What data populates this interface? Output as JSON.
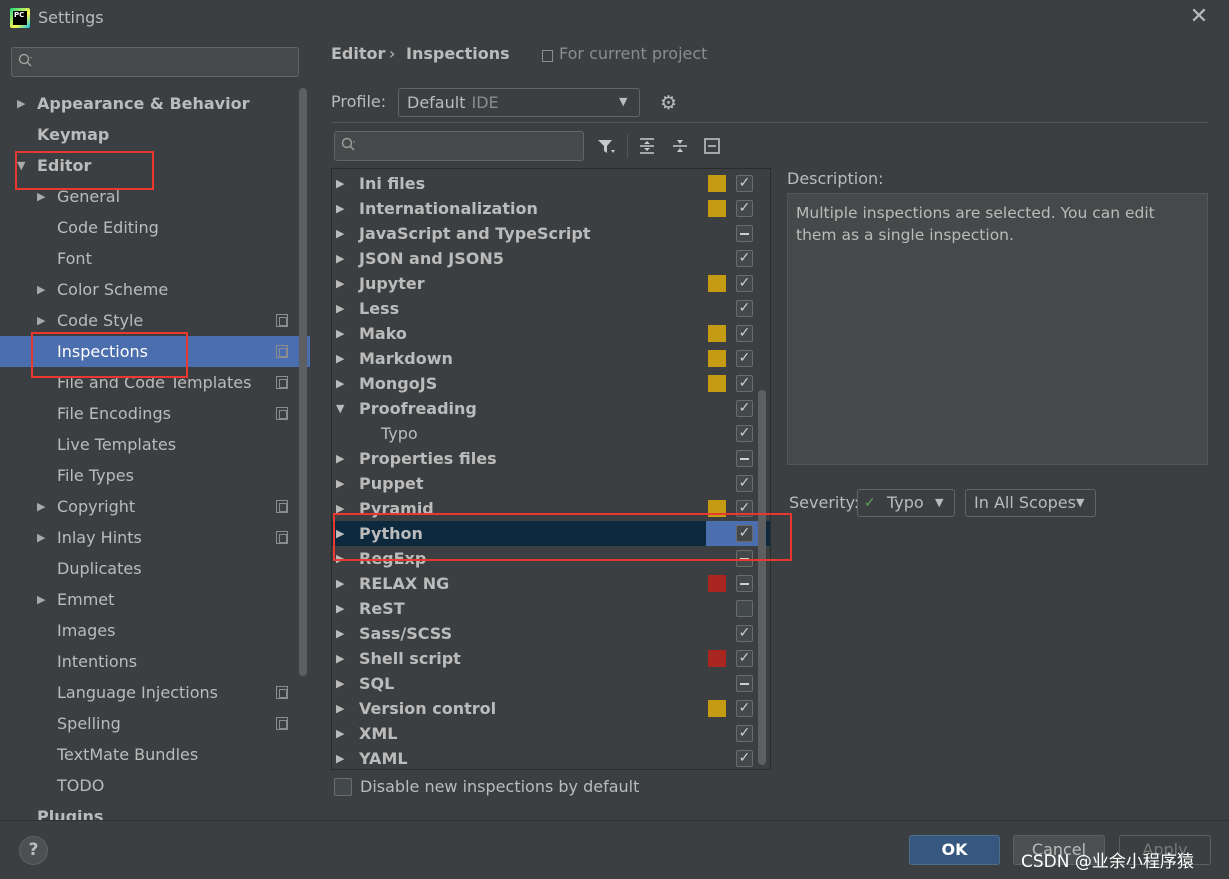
{
  "window": {
    "title": "Settings",
    "icon_text": "PC"
  },
  "sidebar": {
    "search_placeholder": "",
    "items": [
      {
        "label": "Appearance & Behavior",
        "expandable": true,
        "expanded": false,
        "bold": true,
        "level": 0
      },
      {
        "label": "Keymap",
        "expandable": false,
        "bold": true,
        "level": 0
      },
      {
        "label": "Editor",
        "expandable": true,
        "expanded": true,
        "bold": true,
        "level": 0
      },
      {
        "label": "General",
        "expandable": true,
        "level": 1
      },
      {
        "label": "Code Editing",
        "level": 1
      },
      {
        "label": "Font",
        "level": 1
      },
      {
        "label": "Color Scheme",
        "expandable": true,
        "level": 1
      },
      {
        "label": "Code Style",
        "expandable": true,
        "level": 1,
        "project": true
      },
      {
        "label": "Inspections",
        "level": 1,
        "project": true,
        "selected": true
      },
      {
        "label": "File and Code Templates",
        "level": 1,
        "project": true
      },
      {
        "label": "File Encodings",
        "level": 1,
        "project": true
      },
      {
        "label": "Live Templates",
        "level": 1
      },
      {
        "label": "File Types",
        "level": 1
      },
      {
        "label": "Copyright",
        "expandable": true,
        "level": 1,
        "project": true
      },
      {
        "label": "Inlay Hints",
        "expandable": true,
        "level": 1,
        "project": true
      },
      {
        "label": "Duplicates",
        "level": 1
      },
      {
        "label": "Emmet",
        "expandable": true,
        "level": 1
      },
      {
        "label": "Images",
        "level": 1
      },
      {
        "label": "Intentions",
        "level": 1
      },
      {
        "label": "Language Injections",
        "level": 1,
        "project": true
      },
      {
        "label": "Spelling",
        "level": 1,
        "project": true
      },
      {
        "label": "TextMate Bundles",
        "level": 1
      },
      {
        "label": "TODO",
        "level": 1
      },
      {
        "label": "Plugins",
        "bold": true,
        "level": 0
      }
    ]
  },
  "breadcrumb": {
    "parent": "Editor",
    "separator": "›",
    "current": "Inspections",
    "scope_note": "For current project"
  },
  "profile": {
    "label": "Profile:",
    "value": "Default",
    "suffix": "IDE"
  },
  "inspections": [
    {
      "label": "Ini files",
      "severity": "#c49b13",
      "check": "checked"
    },
    {
      "label": "Internationalization",
      "severity": "#c49b13",
      "check": "checked"
    },
    {
      "label": "JavaScript and TypeScript",
      "severity": "",
      "check": "mixed"
    },
    {
      "label": "JSON and JSON5",
      "severity": "",
      "check": "checked"
    },
    {
      "label": "Jupyter",
      "severity": "#c49b13",
      "check": "checked"
    },
    {
      "label": "Less",
      "severity": "",
      "check": "checked"
    },
    {
      "label": "Mako",
      "severity": "#c49b13",
      "check": "checked"
    },
    {
      "label": "Markdown",
      "severity": "#c49b13",
      "check": "checked"
    },
    {
      "label": "MongoJS",
      "severity": "#c49b13",
      "check": "checked"
    },
    {
      "label": "Proofreading",
      "severity": "",
      "check": "checked",
      "expanded": true
    },
    {
      "label": "Typo",
      "severity": "",
      "check": "checked",
      "child": true
    },
    {
      "label": "Properties files",
      "severity": "",
      "check": "mixed"
    },
    {
      "label": "Puppet",
      "severity": "",
      "check": "checked"
    },
    {
      "label": "Pyramid",
      "severity": "#c49b13",
      "check": "checked"
    },
    {
      "label": "Python",
      "severity": "",
      "check": "checked",
      "selected": true
    },
    {
      "label": "RegExp",
      "severity": "",
      "check": "mixed"
    },
    {
      "label": "RELAX NG",
      "severity": "#a8261f",
      "check": "mixed"
    },
    {
      "label": "ReST",
      "severity": "",
      "check": "unchecked"
    },
    {
      "label": "Sass/SCSS",
      "severity": "",
      "check": "checked"
    },
    {
      "label": "Shell script",
      "severity": "#a8261f",
      "check": "checked"
    },
    {
      "label": "SQL",
      "severity": "",
      "check": "mixed"
    },
    {
      "label": "Version control",
      "severity": "#c49b13",
      "check": "checked"
    },
    {
      "label": "XML",
      "severity": "",
      "check": "checked"
    },
    {
      "label": "YAML",
      "severity": "",
      "check": "checked"
    }
  ],
  "disable_new": {
    "label": "Disable new inspections by default",
    "checked": false
  },
  "description": {
    "label": "Description:",
    "text": "Multiple inspections are selected. You can edit them as a single inspection."
  },
  "severity": {
    "label": "Severity:",
    "value": "Typo",
    "scope": "In All Scopes"
  },
  "buttons": {
    "ok": "OK",
    "cancel": "Cancel",
    "apply": "Apply",
    "help": "?"
  },
  "watermark": "CSDN @业余小程序猿",
  "colors": {
    "accent": "#4b6eaf",
    "selection_dark": "#0d293e",
    "highlight_box": "#e8382f"
  }
}
